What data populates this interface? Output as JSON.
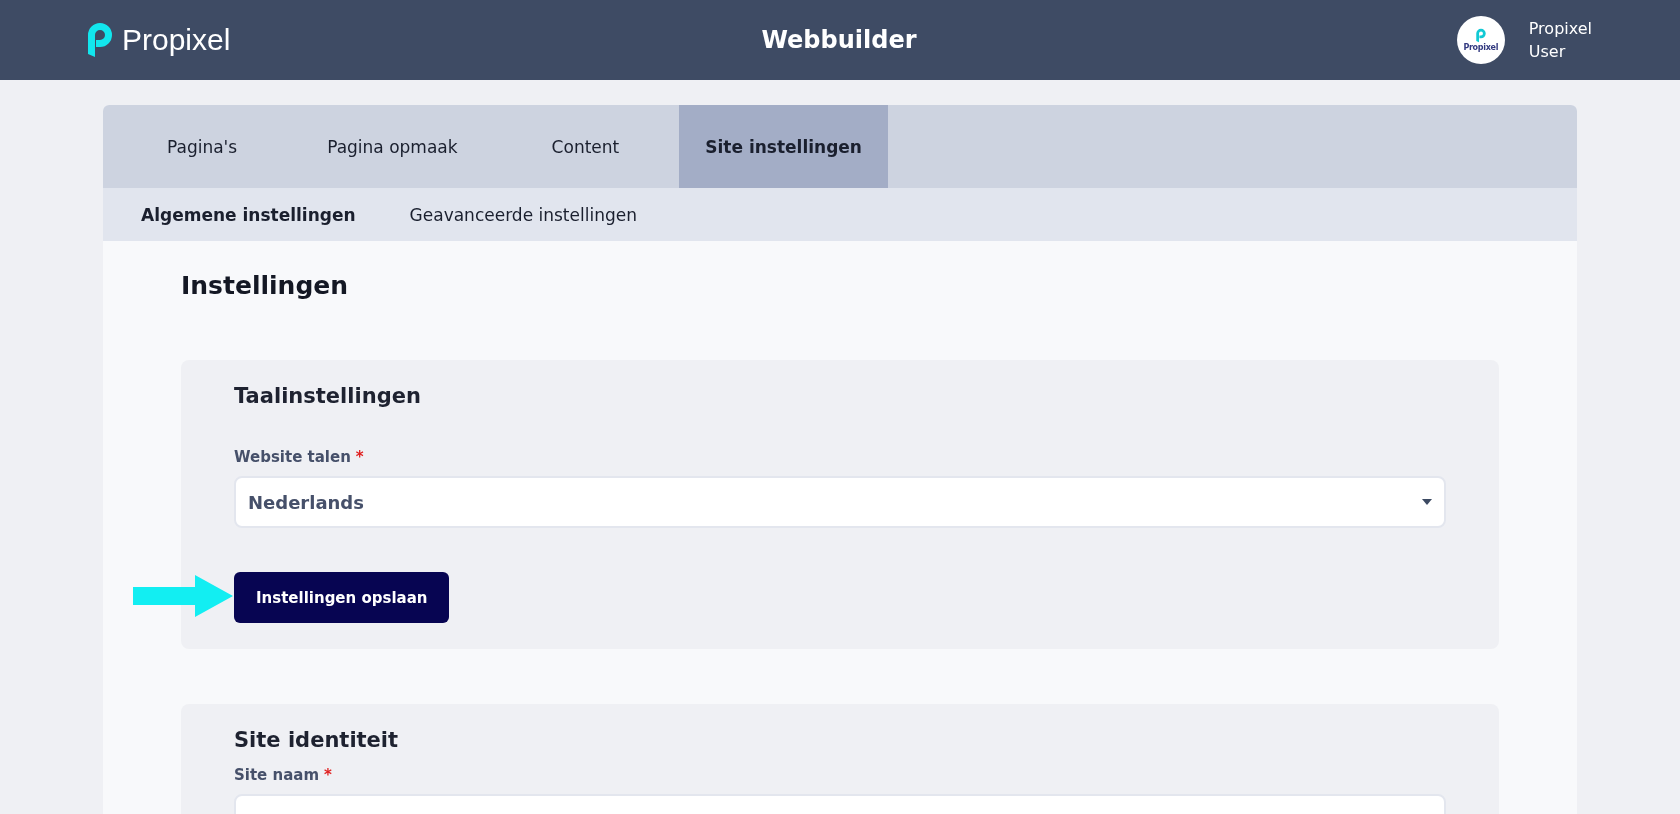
{
  "header": {
    "logo_text": "Propixel",
    "title": "Webbuilder",
    "user": {
      "avatar_text": "Propixel",
      "name": "Propixel",
      "role": "User"
    }
  },
  "tabs": [
    {
      "label": "Pagina's",
      "selected": false
    },
    {
      "label": "Pagina opmaak",
      "selected": false
    },
    {
      "label": "Content",
      "selected": false
    },
    {
      "label": "Site instellingen",
      "selected": true
    }
  ],
  "subtabs": [
    {
      "label": "Algemene instellingen",
      "selected": true
    },
    {
      "label": "Geavanceerde instellingen",
      "selected": false
    }
  ],
  "page_title": "Instellingen",
  "sections": [
    {
      "title": "Taalinstellingen",
      "field": {
        "label": "Website talen",
        "required_mark": "*",
        "kind": "select",
        "value": "Nederlands"
      },
      "button": "Instellingen opslaan",
      "pointer": true
    },
    {
      "title": "Site identiteit",
      "field": {
        "label": "Site naam",
        "required_mark": "*",
        "kind": "text"
      }
    }
  ]
}
